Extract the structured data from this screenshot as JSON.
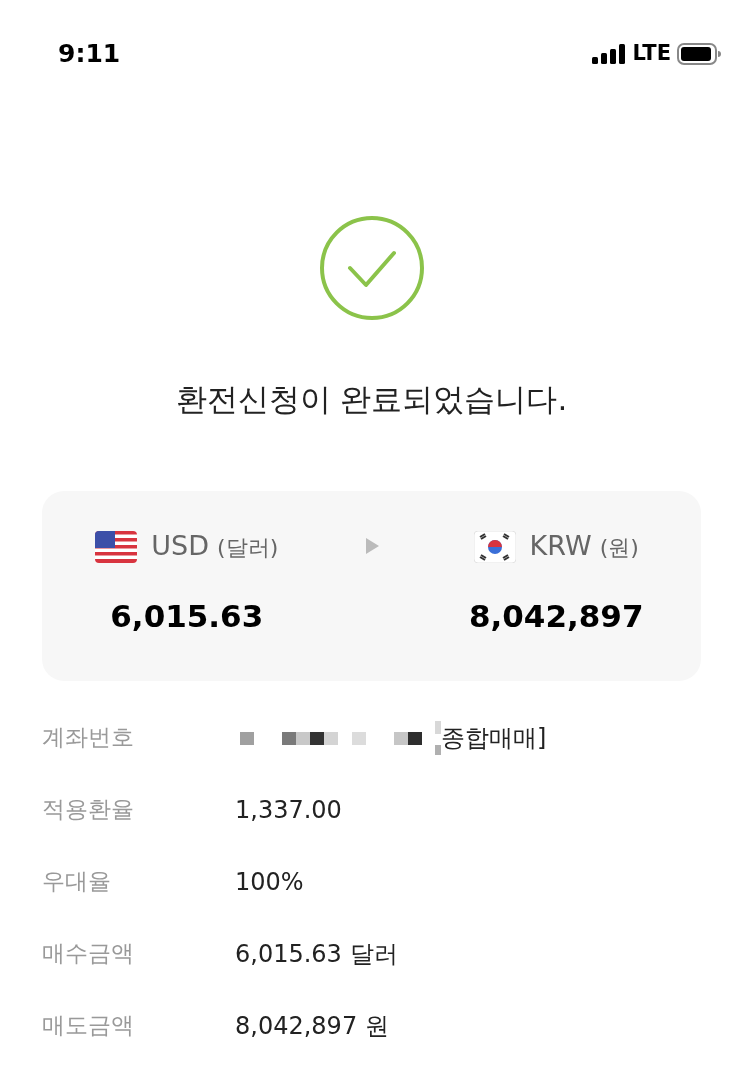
{
  "status_bar": {
    "time": "9:11",
    "network": "LTE"
  },
  "message": "환전신청이 완료되었습니다.",
  "exchange": {
    "from": {
      "kind": "us",
      "code": "USD",
      "name": "(달러)",
      "amount": "6,015.63"
    },
    "to": {
      "kind": "kr",
      "code": "KRW",
      "name": "(원)",
      "amount": "8,042,897"
    }
  },
  "details": [
    {
      "label": "계좌번호",
      "value": "종합매매]",
      "kind": "masked"
    },
    {
      "label": "적용환율",
      "value": "1,337.00",
      "kind": "text"
    },
    {
      "label": "우대율",
      "value": "100%",
      "kind": "text"
    },
    {
      "label": "매수금액",
      "value": "6,015.63 달러",
      "kind": "text"
    },
    {
      "label": "매도금액",
      "value": "8,042,897 원",
      "kind": "text"
    }
  ]
}
